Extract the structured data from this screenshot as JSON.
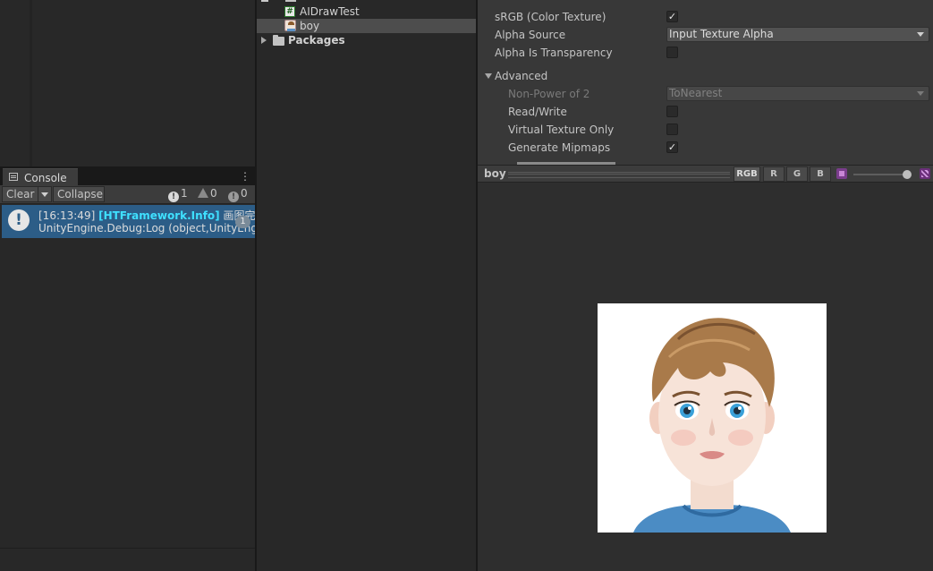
{
  "console": {
    "tab_label": "Console",
    "toolbar": {
      "clear_label": "Clear",
      "collapse_label": "Collapse",
      "info_count": "1",
      "warning_count": "0",
      "error_count": "0"
    },
    "entries": [
      {
        "time": "[16:13:49]",
        "tag": "[HTFramework.Info]",
        "message": "画图完毕",
        "stack": "UnityEngine.Debug:Log (object,UnityEngine",
        "count": "1"
      }
    ]
  },
  "project": {
    "items": [
      {
        "label": "AIDrawTest",
        "icon": "csharp-script-icon"
      },
      {
        "label": "boy",
        "icon": "image-icon",
        "selected": true
      },
      {
        "label": "Packages",
        "icon": "folder-icon"
      }
    ]
  },
  "inspector": {
    "srgb_label": "sRGB (Color Texture)",
    "srgb_checked": true,
    "alpha_source_label": "Alpha Source",
    "alpha_source_value": "Input Texture Alpha",
    "alpha_transparency_label": "Alpha Is Transparency",
    "alpha_transparency_checked": false,
    "advanced_label": "Advanced",
    "npot_label": "Non-Power of 2",
    "npot_value": "ToNearest",
    "read_write_label": "Read/Write",
    "read_write_checked": false,
    "virtual_texture_label": "Virtual Texture Only",
    "virtual_texture_checked": false,
    "mipmaps_label": "Generate Mipmaps",
    "mipmaps_checked": true
  },
  "preview": {
    "title": "boy",
    "channels": [
      "RGB",
      "R",
      "G",
      "B"
    ],
    "active_channel": "RGB",
    "mip_level": 1.0
  },
  "colors": {
    "selection_blue": "#2c5d87",
    "info_tag_cyan": "#3fe0ff",
    "panel_dark": "#282828",
    "inspector_bg": "#383838"
  }
}
